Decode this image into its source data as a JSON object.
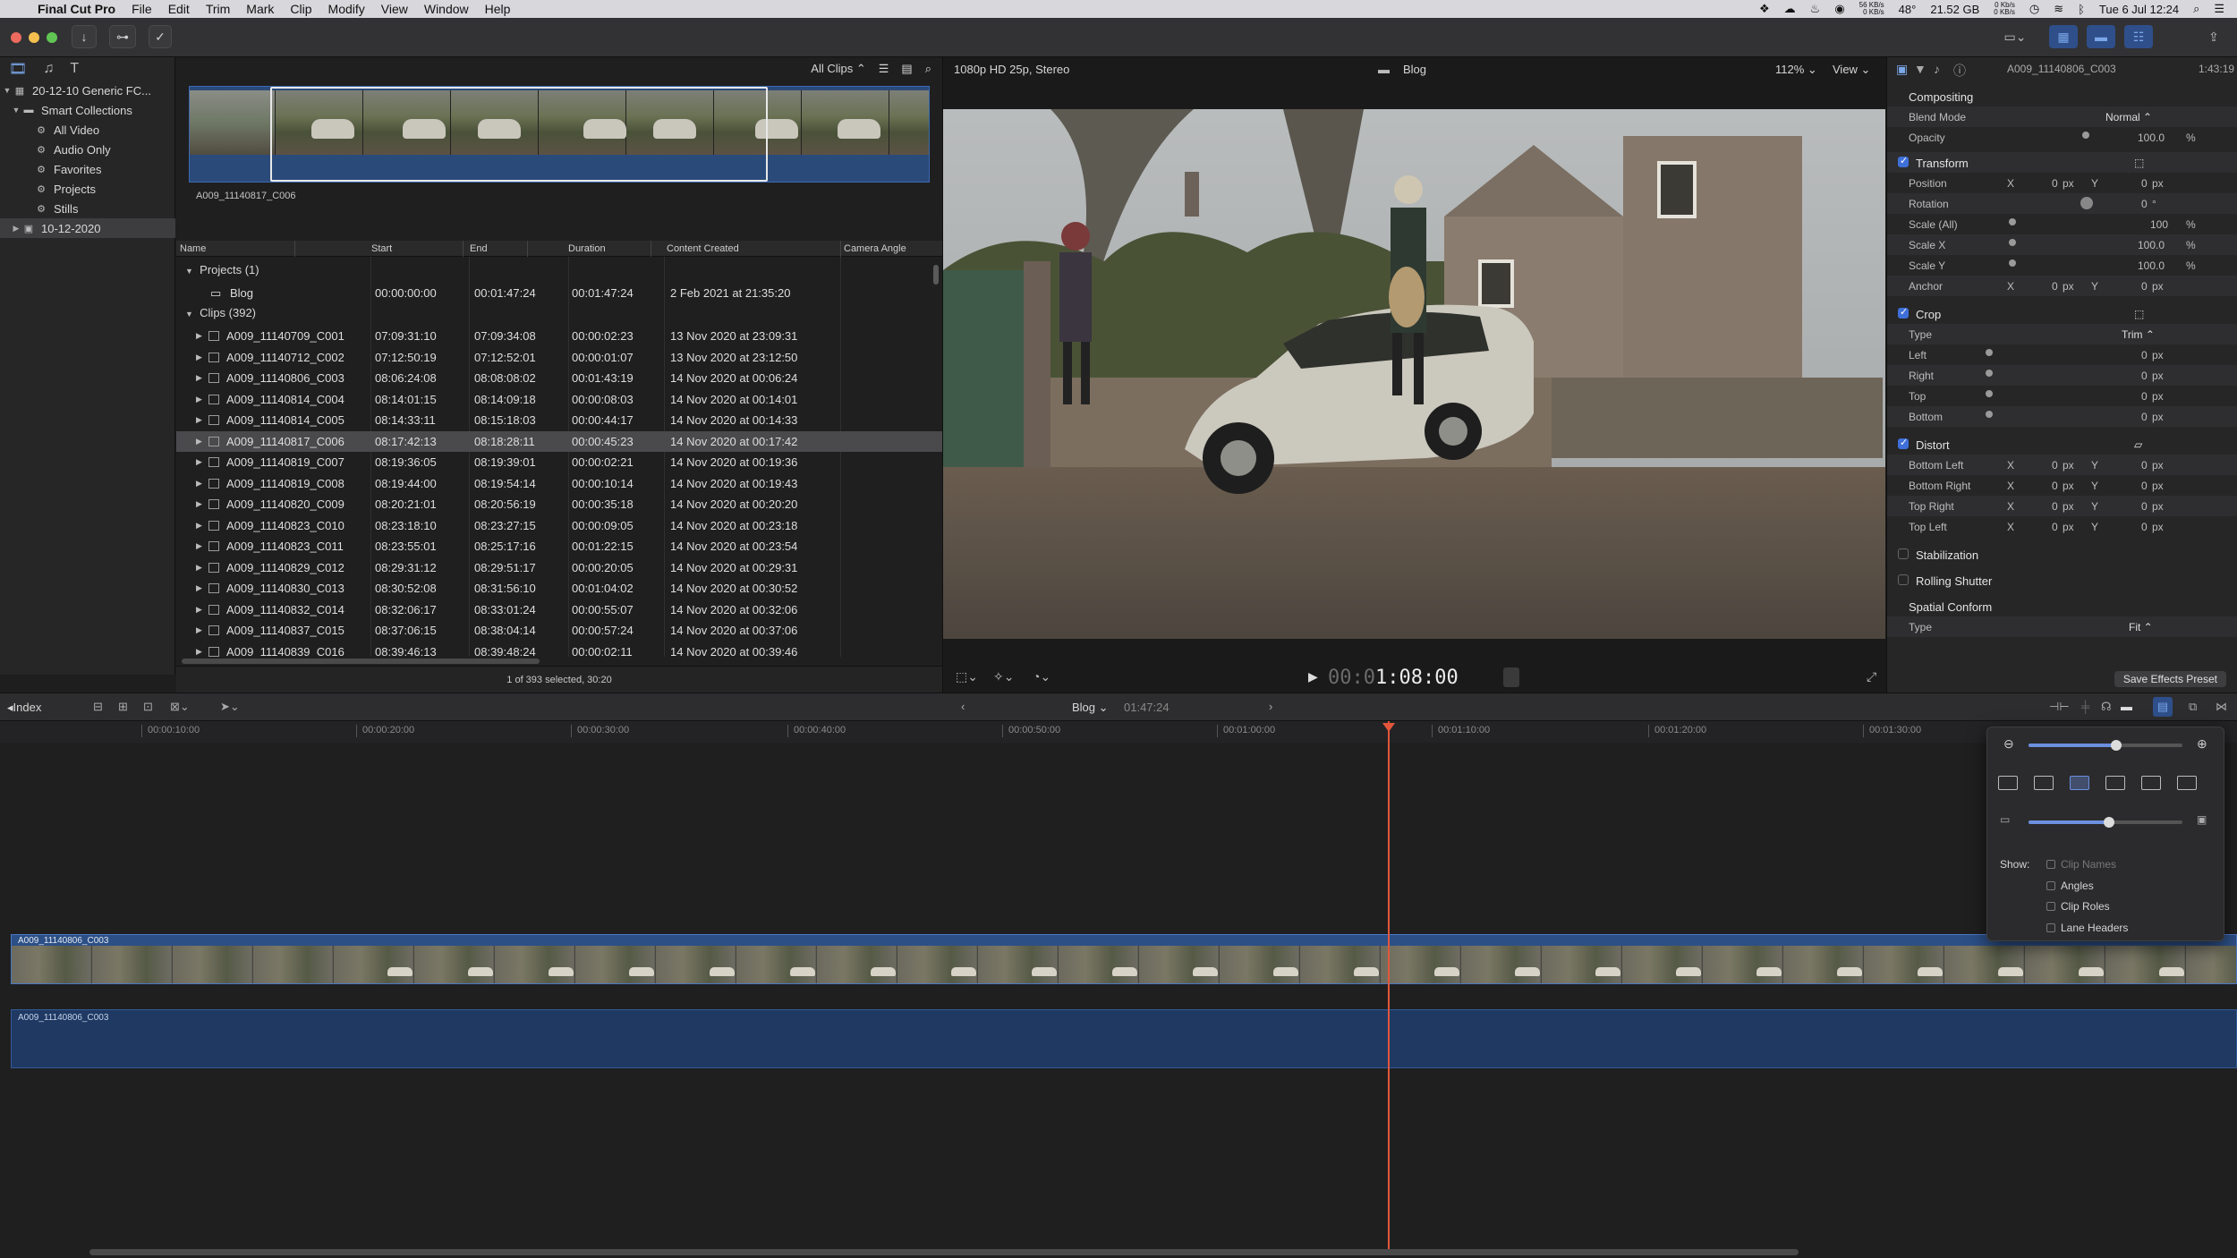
{
  "menubar": {
    "apple": "",
    "app_name": "Final Cut Pro",
    "items": [
      "File",
      "Edit",
      "Trim",
      "Mark",
      "Clip",
      "Modify",
      "View",
      "Window",
      "Help"
    ],
    "net_up": "56 KB/s",
    "net_down": "0 KB/s",
    "temperature": "48°",
    "disk": "21.52 GB",
    "net2_up": "0 Kb/s",
    "net2_down": "0 KB/s",
    "datetime": "Tue 6 Jul  12:24"
  },
  "library": {
    "items": [
      {
        "label": "20-12-10 Generic FC...",
        "icon": "library-icon",
        "indent": 0,
        "disclosure": "▼"
      },
      {
        "label": "Smart Collections",
        "icon": "folder-icon",
        "indent": 1,
        "disclosure": "▼"
      },
      {
        "label": "All Video",
        "icon": "gear-icon",
        "indent": 2,
        "disclosure": ""
      },
      {
        "label": "Audio Only",
        "icon": "gear-icon",
        "indent": 2,
        "disclosure": ""
      },
      {
        "label": "Favorites",
        "icon": "gear-icon",
        "indent": 2,
        "disclosure": ""
      },
      {
        "label": "Projects",
        "icon": "gear-icon",
        "indent": 2,
        "disclosure": ""
      },
      {
        "label": "Stills",
        "icon": "gear-icon",
        "indent": 2,
        "disclosure": ""
      },
      {
        "label": "10-12-2020",
        "icon": "event-icon",
        "indent": 1,
        "disclosure": "▶",
        "selected": true
      }
    ]
  },
  "browser": {
    "filter": "All Clips ⌃",
    "filmstrip_label": "A009_11140817_C006",
    "columns": [
      "Name",
      "Start",
      "End",
      "Duration",
      "Content Created",
      "Camera Angle"
    ],
    "projects_group": "Projects  (1)",
    "projects": [
      {
        "name": "Blog",
        "start": "00:00:00:00",
        "end": "00:01:47:24",
        "duration": "00:01:47:24",
        "created": "2 Feb 2021 at 21:35:20"
      }
    ],
    "clips_group": "Clips  (392)",
    "clips": [
      {
        "name": "A009_11140709_C001",
        "start": "07:09:31:10",
        "end": "07:09:34:08",
        "duration": "00:00:02:23",
        "created": "13 Nov 2020 at 23:09:31"
      },
      {
        "name": "A009_11140712_C002",
        "start": "07:12:50:19",
        "end": "07:12:52:01",
        "duration": "00:00:01:07",
        "created": "13 Nov 2020 at 23:12:50"
      },
      {
        "name": "A009_11140806_C003",
        "start": "08:06:24:08",
        "end": "08:08:08:02",
        "duration": "00:01:43:19",
        "created": "14 Nov 2020 at 00:06:24"
      },
      {
        "name": "A009_11140814_C004",
        "start": "08:14:01:15",
        "end": "08:14:09:18",
        "duration": "00:00:08:03",
        "created": "14 Nov 2020 at 00:14:01"
      },
      {
        "name": "A009_11140814_C005",
        "start": "08:14:33:11",
        "end": "08:15:18:03",
        "duration": "00:00:44:17",
        "created": "14 Nov 2020 at 00:14:33"
      },
      {
        "name": "A009_11140817_C006",
        "start": "08:17:42:13",
        "end": "08:18:28:11",
        "duration": "00:00:45:23",
        "created": "14 Nov 2020 at 00:17:42",
        "selected": true
      },
      {
        "name": "A009_11140819_C007",
        "start": "08:19:36:05",
        "end": "08:19:39:01",
        "duration": "00:00:02:21",
        "created": "14 Nov 2020 at 00:19:36"
      },
      {
        "name": "A009_11140819_C008",
        "start": "08:19:44:00",
        "end": "08:19:54:14",
        "duration": "00:00:10:14",
        "created": "14 Nov 2020 at 00:19:43"
      },
      {
        "name": "A009_11140820_C009",
        "start": "08:20:21:01",
        "end": "08:20:56:19",
        "duration": "00:00:35:18",
        "created": "14 Nov 2020 at 00:20:20"
      },
      {
        "name": "A009_11140823_C010",
        "start": "08:23:18:10",
        "end": "08:23:27:15",
        "duration": "00:00:09:05",
        "created": "14 Nov 2020 at 00:23:18"
      },
      {
        "name": "A009_11140823_C011",
        "start": "08:23:55:01",
        "end": "08:25:17:16",
        "duration": "00:01:22:15",
        "created": "14 Nov 2020 at 00:23:54"
      },
      {
        "name": "A009_11140829_C012",
        "start": "08:29:31:12",
        "end": "08:29:51:17",
        "duration": "00:00:20:05",
        "created": "14 Nov 2020 at 00:29:31"
      },
      {
        "name": "A009_11140830_C013",
        "start": "08:30:52:08",
        "end": "08:31:56:10",
        "duration": "00:01:04:02",
        "created": "14 Nov 2020 at 00:30:52"
      },
      {
        "name": "A009_11140832_C014",
        "start": "08:32:06:17",
        "end": "08:33:01:24",
        "duration": "00:00:55:07",
        "created": "14 Nov 2020 at 00:32:06"
      },
      {
        "name": "A009_11140837_C015",
        "start": "08:37:06:15",
        "end": "08:38:04:14",
        "duration": "00:00:57:24",
        "created": "14 Nov 2020 at 00:37:06"
      },
      {
        "name": "A009_11140839_C016",
        "start": "08:39:46:13",
        "end": "08:39:48:24",
        "duration": "00:00:02:11",
        "created": "14 Nov 2020 at 00:39:46"
      }
    ],
    "status": "1 of 393 selected, 30:20"
  },
  "viewer": {
    "format": "1080p HD 25p, Stereo",
    "project_title": "Blog",
    "zoom": "112% ⌄",
    "view_menu": "View ⌄",
    "timecode_dim": "00:0",
    "timecode": "1:08:00"
  },
  "inspector": {
    "clip_name": "A009_11140806_C003",
    "clip_duration": "1:43:19",
    "compositing": "Compositing",
    "blend_mode_label": "Blend Mode",
    "blend_mode_value": "Normal ⌃",
    "opacity_label": "Opacity",
    "opacity_value": "100.0",
    "opacity_unit": "%",
    "transform": "Transform",
    "position_label": "Position",
    "position_x": "0",
    "position_y": "0",
    "rotation_label": "Rotation",
    "rotation_value": "0",
    "rotation_unit": "°",
    "scale_all_label": "Scale (All)",
    "scale_all_value": "100",
    "scale_x_label": "Scale X",
    "scale_x_value": "100.0",
    "scale_y_label": "Scale Y",
    "scale_y_value": "100.0",
    "anchor_label": "Anchor",
    "anchor_x": "0",
    "anchor_y": "0",
    "crop": "Crop",
    "crop_type_label": "Type",
    "crop_type_value": "Trim ⌃",
    "left_label": "Left",
    "right_label": "Right",
    "top_label": "Top",
    "bottom_label": "Bottom",
    "crop_value": "0",
    "distort": "Distort",
    "bottom_left_label": "Bottom Left",
    "bottom_right_label": "Bottom Right",
    "top_right_label": "Top Right",
    "top_left_label": "Top Left",
    "distort_value": "0",
    "stabilization": "Stabilization",
    "rolling_shutter": "Rolling Shutter",
    "spatial_conform": "Spatial Conform",
    "conform_type_label": "Type",
    "conform_type_value": "Fit ⌃",
    "px": "px",
    "x": "X",
    "y": "Y",
    "save_preset": "Save Effects Preset"
  },
  "timeline": {
    "index": "Index",
    "project": "Blog ⌄",
    "duration": "01:47:24",
    "ruler": [
      "00:00:10:00",
      "00:00:20:00",
      "00:00:30:00",
      "00:00:40:00",
      "00:00:50:00",
      "00:01:00:00",
      "00:01:10:00",
      "00:01:20:00",
      "00:01:30:00"
    ],
    "video_clip": "A009_11140806_C003",
    "audio_clip": "A009_11140806_C003"
  },
  "appearance_popover": {
    "show_label": "Show:",
    "options": [
      {
        "label": "Clip Names",
        "disabled": true
      },
      {
        "label": "Angles",
        "disabled": false
      },
      {
        "label": "Clip Roles",
        "disabled": false
      },
      {
        "label": "Lane Headers",
        "disabled": false
      }
    ]
  },
  "colors": {
    "accent": "#3f6fd8",
    "playhead": "#e2563b",
    "clip_video": "#2c4f86",
    "clip_audio": "#1f3963"
  }
}
